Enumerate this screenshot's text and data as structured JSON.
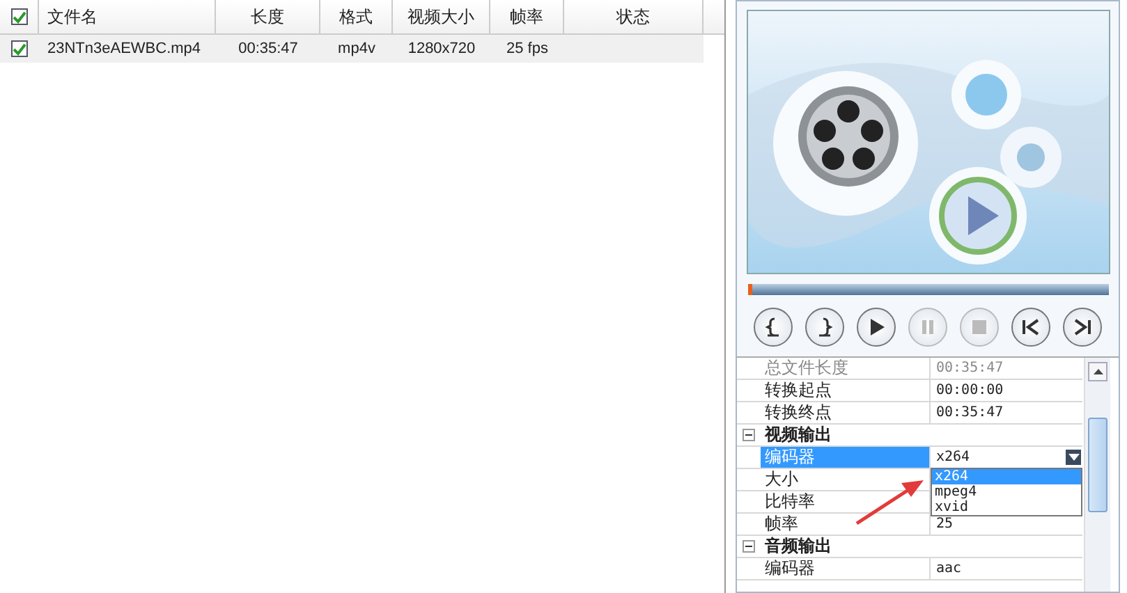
{
  "file_list": {
    "header_checkbox": {
      "checked": true
    },
    "columns": [
      "文件名",
      "长度",
      "格式",
      "视频大小",
      "帧率",
      "状态"
    ],
    "rows": [
      {
        "checked": true,
        "selected": true,
        "cells": [
          "23NTn3eAEWBC.mp4",
          "00:35:47",
          "mp4v",
          "1280x720",
          "25 fps"
        ]
      }
    ]
  },
  "player": {
    "progress": {
      "level": 0
    },
    "buttons": [
      {
        "kind": "mark-in",
        "disabled": false
      },
      {
        "kind": "mark-out",
        "disabled": false
      },
      {
        "kind": "play",
        "disabled": false
      },
      {
        "kind": "pause",
        "disabled": true
      },
      {
        "kind": "stop",
        "disabled": true
      },
      {
        "kind": "prev",
        "disabled": false
      },
      {
        "kind": "next",
        "disabled": false
      }
    ]
  },
  "properties": {
    "rows": [
      {
        "kind": "field",
        "label": "总文件长度",
        "value": "00:35:47",
        "disabled": true,
        "selected": false
      },
      {
        "kind": "field",
        "label": "转换起点",
        "value": "00:00:00",
        "disabled": false,
        "selected": false
      },
      {
        "kind": "field",
        "label": "转换终点",
        "value": "00:35:47",
        "disabled": false,
        "selected": false
      },
      {
        "kind": "group",
        "label": "视频输出",
        "expanded": true,
        "children": [
          {
            "kind": "dropdown",
            "label": "编码器",
            "value": "x264",
            "disabled": false,
            "selected": true,
            "options": [
              {
                "label": "x264",
                "selected": true
              },
              {
                "label": "mpeg4",
                "selected": false
              },
              {
                "label": "xvid",
                "selected": false
              }
            ]
          },
          {
            "kind": "field",
            "label": "大小",
            "disabled": false,
            "selected": false
          },
          {
            "kind": "field",
            "label": "比特率",
            "disabled": false,
            "selected": false
          },
          {
            "kind": "field",
            "label": "帧率",
            "value": "25",
            "disabled": false,
            "selected": false
          }
        ]
      },
      {
        "kind": "group",
        "label": "音频输出",
        "expanded": true,
        "children": [
          {
            "kind": "field",
            "label": "编码器",
            "value": "aac",
            "disabled": false,
            "selected": false
          }
        ]
      }
    ]
  }
}
